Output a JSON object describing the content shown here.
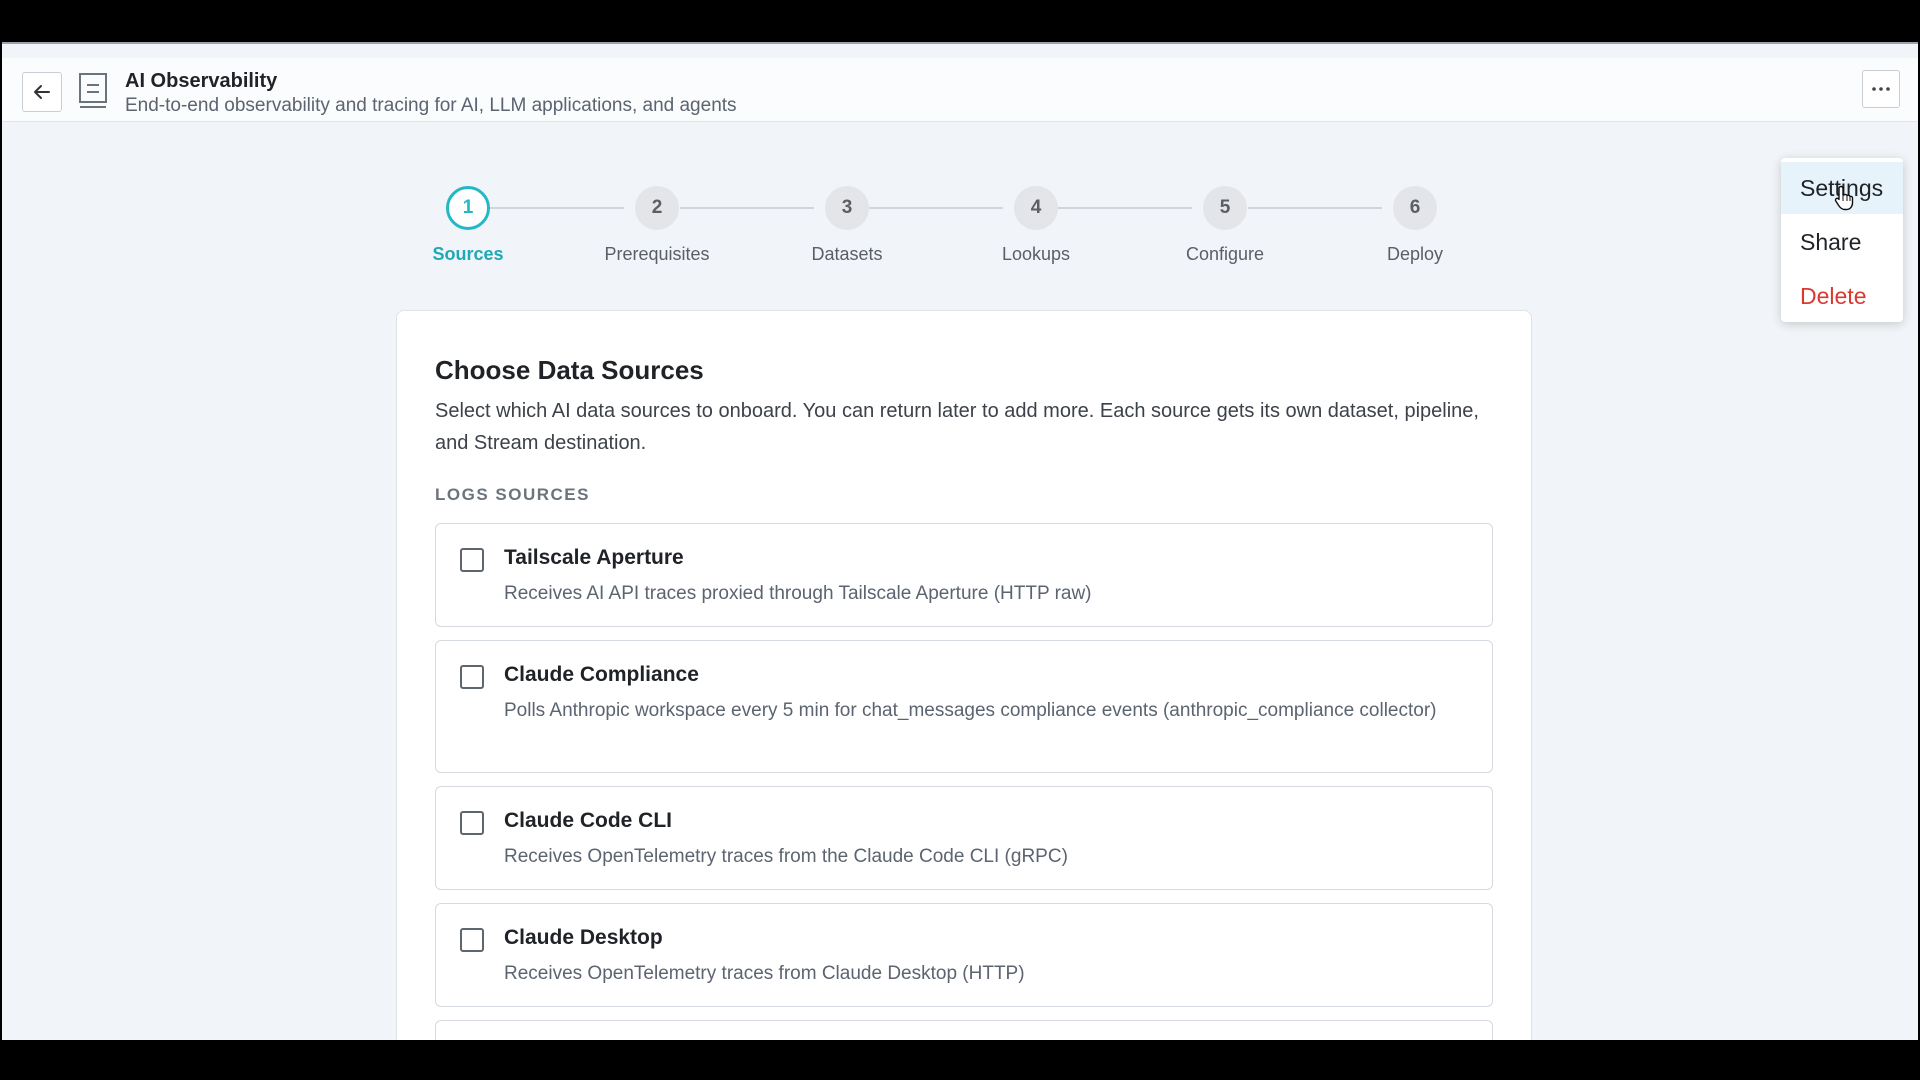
{
  "header": {
    "title": "AI Observability",
    "subtitle": "End-to-end observability and tracing for AI, LLM applications, and agents"
  },
  "icons": {
    "back": "arrow-left-icon",
    "pack": "pack-icon",
    "more": "more-horizontal-icon"
  },
  "steps": [
    {
      "number": "1",
      "label": "Sources",
      "active": true
    },
    {
      "number": "2",
      "label": "Prerequisites",
      "active": false
    },
    {
      "number": "3",
      "label": "Datasets",
      "active": false
    },
    {
      "number": "4",
      "label": "Lookups",
      "active": false
    },
    {
      "number": "5",
      "label": "Configure",
      "active": false
    },
    {
      "number": "6",
      "label": "Deploy",
      "active": false
    }
  ],
  "card": {
    "title": "Choose Data Sources",
    "description": "Select which AI data sources to onboard. You can return later to add more. Each source gets its own dataset, pipeline, and Stream destination.",
    "section_label": "LOGS SOURCES",
    "sources": [
      {
        "name": "Tailscale Aperture",
        "description": "Receives AI API traces proxied through Tailscale Aperture (HTTP raw)",
        "checked": false
      },
      {
        "name": "Claude Compliance",
        "description": "Polls Anthropic workspace every 5 min for chat_messages compliance events (anthropic_compliance collector)",
        "checked": false
      },
      {
        "name": "Claude Code CLI",
        "description": "Receives OpenTelemetry traces from the Claude Code CLI (gRPC)",
        "checked": false
      },
      {
        "name": "Claude Desktop",
        "description": "Receives OpenTelemetry traces from Claude Desktop (HTTP)",
        "checked": false
      }
    ]
  },
  "menu": {
    "items": [
      {
        "label": "Settings",
        "hovered": true
      },
      {
        "label": "Share",
        "hovered": false
      },
      {
        "label": "Delete",
        "danger": true
      }
    ]
  },
  "colors": {
    "accent": "#23b8c6",
    "danger": "#d93a30",
    "menu_hover": "#e6f3fb",
    "page_background": "#f1f4f8"
  }
}
